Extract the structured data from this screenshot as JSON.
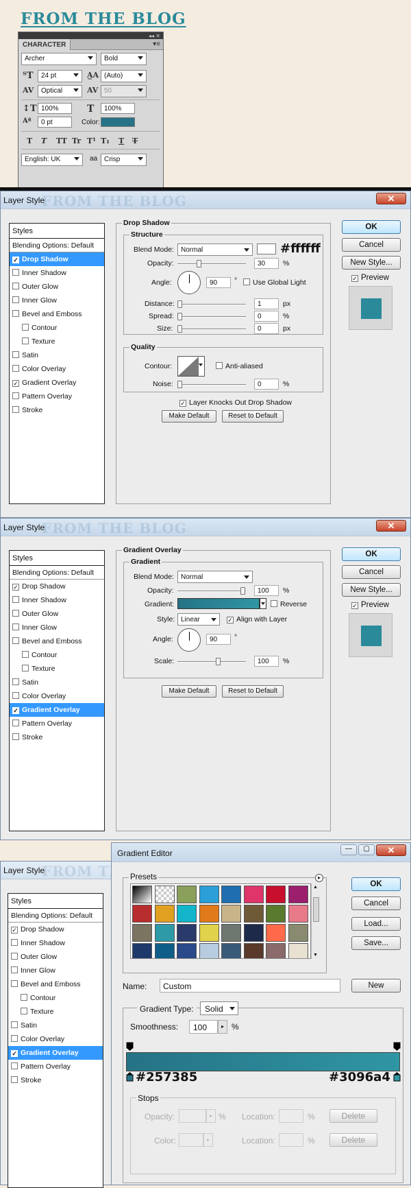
{
  "blog": {
    "title": "FROM THE BLOG"
  },
  "character": {
    "tab": "CHARACTER",
    "font": "Archer",
    "weight": "Bold",
    "size": "24 pt",
    "leading": "(Auto)",
    "kerning": "Optical",
    "tracking": "50",
    "vscale": "100%",
    "hscale": "100%",
    "baseline": "0 pt",
    "color_label": "Color:",
    "color": "#257385",
    "language": "English: UK",
    "antialias": "Crisp",
    "aa_label": "aa",
    "style_buttons": [
      "T",
      "T",
      "TT",
      "Tr",
      "T¹",
      "T₁",
      "T",
      "T"
    ]
  },
  "styles_list": {
    "header": "Styles",
    "blending": "Blending Options: Default",
    "items": [
      {
        "label": "Drop Shadow",
        "checked": true,
        "indent": false
      },
      {
        "label": "Inner Shadow",
        "checked": false,
        "indent": false
      },
      {
        "label": "Outer Glow",
        "checked": false,
        "indent": false
      },
      {
        "label": "Inner Glow",
        "checked": false,
        "indent": false
      },
      {
        "label": "Bevel and Emboss",
        "checked": false,
        "indent": false
      },
      {
        "label": "Contour",
        "checked": false,
        "indent": true
      },
      {
        "label": "Texture",
        "checked": false,
        "indent": true
      },
      {
        "label": "Satin",
        "checked": false,
        "indent": false
      },
      {
        "label": "Color Overlay",
        "checked": false,
        "indent": false
      },
      {
        "label": "Gradient Overlay",
        "checked": true,
        "indent": false
      },
      {
        "label": "Pattern Overlay",
        "checked": false,
        "indent": false
      },
      {
        "label": "Stroke",
        "checked": false,
        "indent": false
      }
    ]
  },
  "layer_style_1": {
    "title": "Layer Style",
    "ghost": "FROM THE BLOG",
    "selected": "Drop Shadow",
    "section": "Drop Shadow",
    "structure": "Structure",
    "blend_label": "Blend Mode:",
    "blend_mode": "Normal",
    "color_hex": "#ffffff",
    "opacity_label": "Opacity:",
    "opacity": "30",
    "angle_label": "Angle:",
    "angle": "90",
    "deg": "°",
    "global_light": "Use Global Light",
    "distance_label": "Distance:",
    "distance": "1",
    "spread_label": "Spread:",
    "spread": "0",
    "size_label": "Size:",
    "size": "0",
    "quality": "Quality",
    "contour_label": "Contour:",
    "anti_aliased": "Anti-aliased",
    "noise_label": "Noise:",
    "noise": "0",
    "knocks_out": "Layer Knocks Out Drop Shadow",
    "px": "px",
    "pct": "%"
  },
  "layer_style_2": {
    "title": "Layer Style",
    "ghost": "FROM THE BLOG",
    "selected": "Gradient Overlay",
    "section": "Gradient Overlay",
    "sub": "Gradient",
    "blend_label": "Blend Mode:",
    "blend_mode": "Normal",
    "opacity_label": "Opacity:",
    "opacity": "100",
    "gradient_label": "Gradient:",
    "reverse": "Reverse",
    "style_label": "Style:",
    "style": "Linear",
    "align": "Align with Layer",
    "angle_label": "Angle:",
    "angle": "90",
    "deg": "°",
    "scale_label": "Scale:",
    "scale": "100",
    "pct": "%"
  },
  "dialog_buttons": {
    "ok": "OK",
    "cancel": "Cancel",
    "new_style": "New Style...",
    "preview": "Preview",
    "make_default": "Make Default",
    "reset_default": "Reset to Default"
  },
  "layer_style_3": {
    "title": "Layer Style",
    "ghost": "FROM THE BLOG"
  },
  "gradient_editor": {
    "title": "Gradient Editor",
    "presets": "Presets",
    "ok": "OK",
    "cancel": "Cancel",
    "load": "Load...",
    "save": "Save...",
    "name_label": "Name:",
    "name": "Custom",
    "new": "New",
    "type_label": "Gradient Type:",
    "type": "Solid",
    "smooth_label": "Smoothness:",
    "smooth": "100",
    "pct": "%",
    "left_hex": "#257385",
    "right_hex": "#3096a4",
    "stops": "Stops",
    "opacity_label": "Opacity:",
    "color_label": "Color:",
    "location_label": "Location:",
    "delete": "Delete",
    "preset_colors": [
      "grad-bw",
      "checker",
      "#8aa05a",
      "#2a9fd8",
      "#1f6fb0",
      "#e0356a",
      "#c8102e",
      "#9c1f6e",
      "#b82d2d",
      "#e0a020",
      "#12b5c9",
      "#e07a1a",
      "#c9b48a",
      "#6f5a38",
      "#5a7a2e",
      "#e87a8a",
      "#7a7460",
      "#2e9aa8",
      "#2a3a6a",
      "#e0d24a",
      "#6e7670",
      "#1e2a4a",
      "#ff6a4a",
      "#8a8a70",
      "#1e3a6a",
      "#0f5e8a",
      "#2a4a8a",
      "#b8cce0",
      "#3a5a7a",
      "#5a3a2a",
      "#8a6a6a",
      "#e8e0d0"
    ]
  }
}
